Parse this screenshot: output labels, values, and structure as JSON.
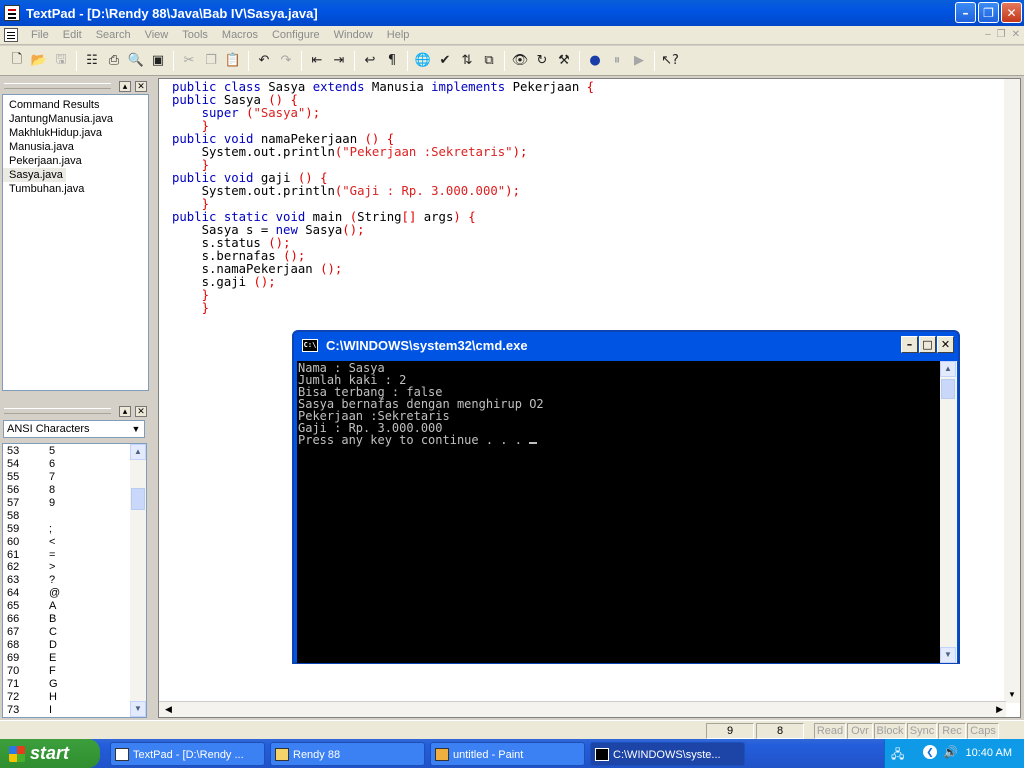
{
  "window": {
    "title": "TextPad - [D:\\Rendy 88\\Java\\Bab IV\\Sasya.java]"
  },
  "menu": [
    "File",
    "Edit",
    "Search",
    "View",
    "Tools",
    "Macros",
    "Configure",
    "Window",
    "Help"
  ],
  "files": {
    "items": [
      "Command Results",
      "JantungManusia.java",
      "MakhlukHidup.java",
      "Manusia.java",
      "Pekerjaan.java",
      "Sasya.java",
      "Tumbuhan.java"
    ],
    "selected": "Sasya.java"
  },
  "clipLibrary": {
    "selected": "ANSI Characters",
    "rows": [
      [
        "53",
        "5"
      ],
      [
        "54",
        "6"
      ],
      [
        "55",
        "7"
      ],
      [
        "56",
        "8"
      ],
      [
        "57",
        "9"
      ],
      [
        "58",
        ""
      ],
      [
        "59",
        ";"
      ],
      [
        "60",
        "<"
      ],
      [
        "61",
        "="
      ],
      [
        "62",
        ">"
      ],
      [
        "63",
        "?"
      ],
      [
        "64",
        "@"
      ],
      [
        "65",
        "A"
      ],
      [
        "66",
        "B"
      ],
      [
        "67",
        "C"
      ],
      [
        "68",
        "D"
      ],
      [
        "69",
        "E"
      ],
      [
        "70",
        "F"
      ],
      [
        "71",
        "G"
      ],
      [
        "72",
        "H"
      ],
      [
        "73",
        "I"
      ]
    ]
  },
  "code": [
    "public class Sasya extends Manusia implements Pekerjaan {",
    "public Sasya () {",
    "    super (\"Sasya\");",
    "    }",
    "public void namaPekerjaan () {",
    "    System.out.println(\"Pekerjaan :Sekretaris\");",
    "    }",
    "public void gaji () {",
    "    System.out.println(\"Gaji : Rp. 3.000.000\");",
    "    }",
    "public static void main (String[] args) {",
    "    Sasya s = new Sasya();",
    "    s.status ();",
    "    s.bernafas ();",
    "    s.namaPekerjaan ();",
    "    s.gaji ();",
    "    }",
    "    }"
  ],
  "console": {
    "title": "C:\\WINDOWS\\system32\\cmd.exe",
    "lines": [
      "Nama : Sasya",
      "Jumlah kaki : 2",
      "Bisa terbang : false",
      "Sasya bernafas dengan menghirup O2",
      "Pekerjaan :Sekretaris",
      "Gaji : Rp. 3.000.000",
      "Press any key to continue . . . "
    ]
  },
  "status": {
    "line": "9",
    "col": "8",
    "flags": [
      "Read",
      "Ovr",
      "Block",
      "Sync",
      "Rec",
      "Caps"
    ]
  },
  "taskbar": {
    "start": "start",
    "tasks": [
      "TextPad - [D:\\Rendy ...",
      "Rendy 88",
      "untitled - Paint",
      "C:\\WINDOWS\\syste..."
    ],
    "clock": "10:40 AM"
  }
}
